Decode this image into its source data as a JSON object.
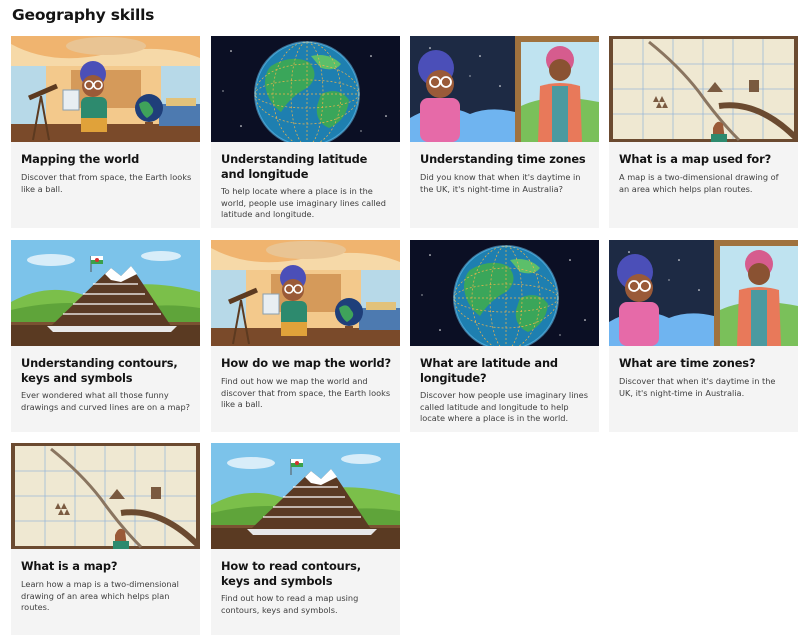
{
  "page": {
    "title": "Geography skills"
  },
  "cards": [
    {
      "title": "Mapping the world",
      "description": "Discover that from space, the Earth looks like a ball.",
      "image": "explorer-with-telescope-and-globe"
    },
    {
      "title": "Understanding latitude and longitude",
      "description": "To help locate where a place is in the world, people use imaginary lines called latitude and longitude.",
      "image": "earth-with-latitude-longitude-lines"
    },
    {
      "title": "Understanding time zones",
      "description": "Did you know that when it's daytime in the UK, it's night-time in Australia?",
      "image": "night-and-day-phone-call"
    },
    {
      "title": "What is a map used for?",
      "description": "A map is a two-dimensional drawing of an area which helps plan routes.",
      "image": "grid-map-with-pointer"
    },
    {
      "title": "Understanding contours, keys and symbols",
      "description": "Ever wondered what all those funny drawings and curved lines are on a map?",
      "image": "layered-mountain-cake-with-welsh-flag"
    },
    {
      "title": "How do we map the world?",
      "description": "Find out how we map the world and discover that from space, the Earth looks like a ball.",
      "image": "explorer-with-telescope-and-globe"
    },
    {
      "title": "What are latitude and longitude?",
      "description": "Discover how people use imaginary lines called latitude and longitude to help locate where a place is in the world.",
      "image": "earth-with-latitude-longitude-lines"
    },
    {
      "title": "What are time zones?",
      "description": "Discover that when it's daytime in the UK, it's night-time in Australia.",
      "image": "night-and-day-phone-call"
    },
    {
      "title": "What is a map?",
      "description": "Learn how a map is a two-dimensional drawing of an area which helps plan routes.",
      "image": "grid-map-with-pointer"
    },
    {
      "title": "How to read contours, keys and symbols",
      "description": "Find out how to read a map using contours, keys and symbols.",
      "image": "layered-mountain-cake-with-welsh-flag"
    }
  ]
}
